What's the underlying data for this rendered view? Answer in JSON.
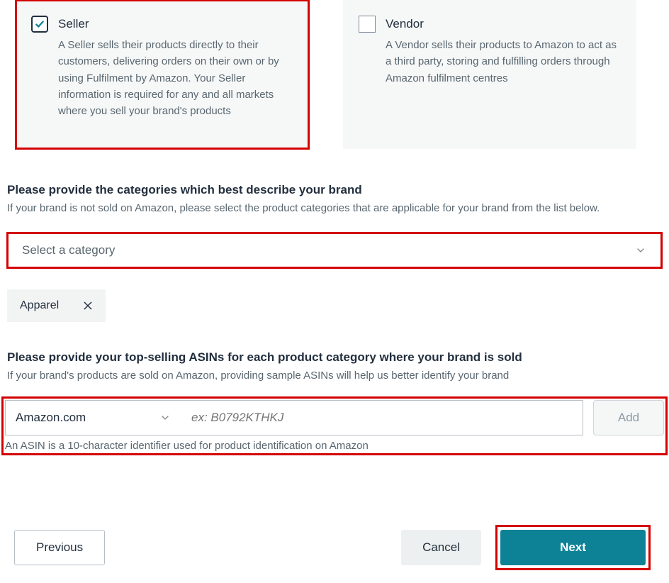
{
  "options": {
    "seller": {
      "title": "Seller",
      "desc": "A Seller sells their products directly to their customers, delivering orders on their own or by using Fulfilment by Amazon. Your Seller information is required for any and all markets where you sell your brand's products",
      "checked": true
    },
    "vendor": {
      "title": "Vendor",
      "desc": "A Vendor sells their products to Amazon to act as a third party, storing and fulfilling orders through Amazon fulfilment centres",
      "checked": false
    }
  },
  "categories_section": {
    "heading": "Please provide the categories which best describe your brand",
    "sub": "If your brand is not sold on Amazon, please select the product categories that are applicable for your brand from the list below.",
    "placeholder": "Select a category",
    "selected_tag": "Apparel"
  },
  "asin_section": {
    "heading": "Please provide your top-selling ASINs for each product category where your brand is sold",
    "sub": "If your brand's products are sold on Amazon, providing sample ASINs will help us better identify your brand",
    "market": "Amazon.com",
    "placeholder": "ex: B0792KTHKJ",
    "add_label": "Add",
    "helper": "An ASIN is a 10-character identifier used for product identification on Amazon"
  },
  "buttons": {
    "previous": "Previous",
    "cancel": "Cancel",
    "next": "Next"
  }
}
